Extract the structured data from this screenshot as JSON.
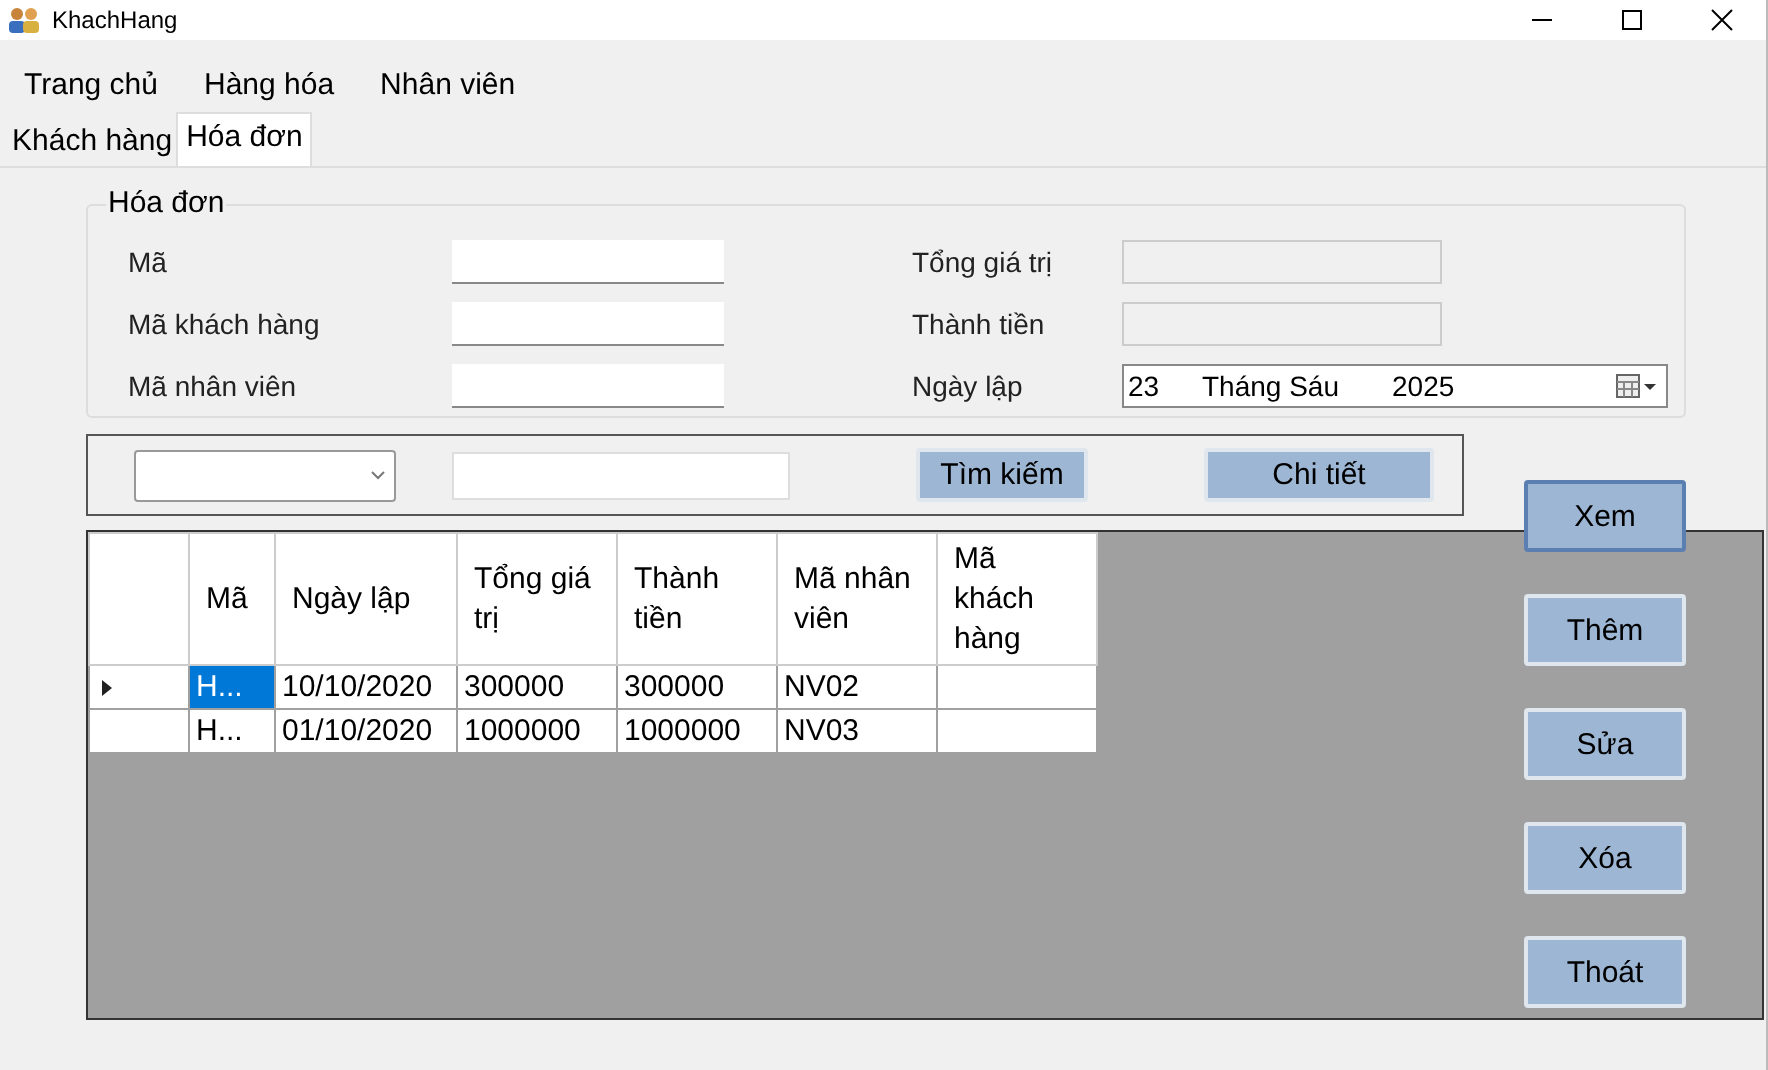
{
  "window": {
    "title": "KhachHang"
  },
  "menu": [
    "Trang chủ",
    "Hàng hóa",
    "Nhân viên"
  ],
  "tabs": [
    {
      "label": "Khách hàng",
      "selected": false
    },
    {
      "label": "Hóa đơn",
      "selected": true
    }
  ],
  "group": {
    "title": "Hóa đơn",
    "left_fields": [
      {
        "label": "Mã",
        "disabled": false
      },
      {
        "label": "Mã khách hàng",
        "disabled": false
      },
      {
        "label": "Mã nhân viên",
        "disabled": false
      }
    ],
    "right_fields": [
      {
        "label": "Tổng giá trị",
        "disabled": true
      },
      {
        "label": "Thành tiền",
        "disabled": true
      }
    ],
    "date": {
      "label": "Ngày lập",
      "day": "23",
      "month": "Tháng Sáu",
      "year": "2025"
    }
  },
  "search": {
    "button": "Tìm kiếm",
    "detail_button": "Chi tiết"
  },
  "table": {
    "columns": [
      "Mã",
      "Ngày lập",
      "Tổng giá trị",
      "Thành tiền",
      "Mã nhân viên",
      "Mã khách hàng"
    ],
    "rows": [
      {
        "selected": true,
        "cells": [
          "H...",
          "10/10/2020",
          "300000",
          "300000",
          "NV02",
          ""
        ]
      },
      {
        "selected": false,
        "cells": [
          "H...",
          "01/10/2020",
          "1000000",
          "1000000",
          "NV03",
          ""
        ]
      }
    ]
  },
  "buttons": [
    {
      "label": "Xem",
      "focused": true
    },
    {
      "label": "Thêm",
      "focused": false
    },
    {
      "label": "Sửa",
      "focused": false
    },
    {
      "label": "Xóa",
      "focused": false
    },
    {
      "label": "Thoát",
      "focused": false
    }
  ]
}
